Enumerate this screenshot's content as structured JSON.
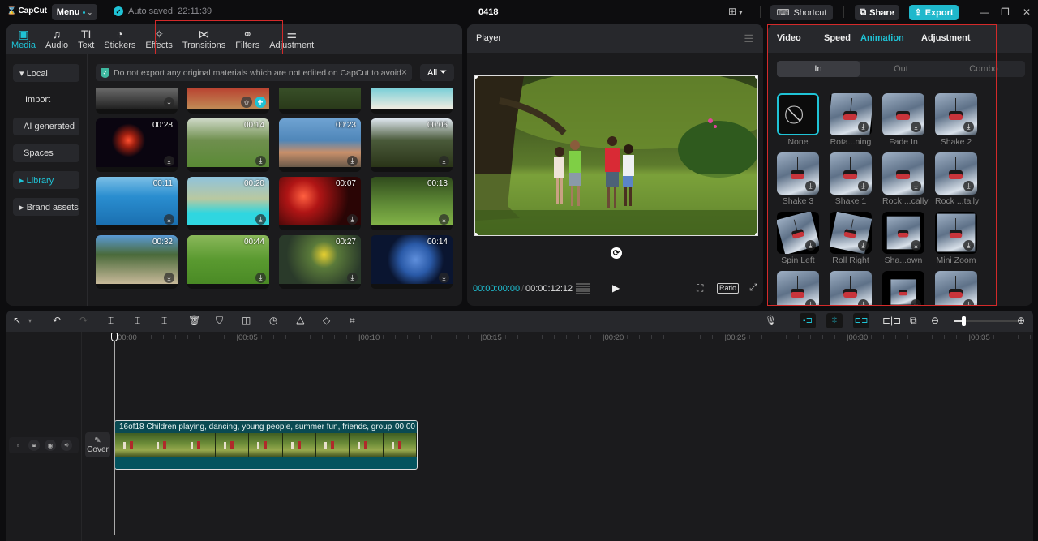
{
  "titlebar": {
    "app_name": "CapCut",
    "menu_label": "Menu",
    "autosave_text": "Auto saved: 22:11:39",
    "project_name": "0418",
    "shortcut_label": "Shortcut",
    "share_label": "Share",
    "export_label": "Export",
    "accent_color": "#1fc3d6"
  },
  "media_tabs": [
    {
      "label": "Media",
      "icon": "media-icon",
      "glyph": "▣",
      "active": true
    },
    {
      "label": "Audio",
      "icon": "audio-icon",
      "glyph": "♫",
      "active": false
    },
    {
      "label": "Text",
      "icon": "text-icon",
      "glyph": "TI",
      "active": false
    },
    {
      "label": "Stickers",
      "icon": "stickers-icon",
      "glyph": "◔",
      "active": false
    },
    {
      "label": "Effects",
      "icon": "effects-icon",
      "glyph": "✧",
      "active": false
    },
    {
      "label": "Transitions",
      "icon": "transitions-icon",
      "glyph": "⋈",
      "active": false
    },
    {
      "label": "Filters",
      "icon": "filters-icon",
      "glyph": "⚭",
      "active": false
    },
    {
      "label": "Adjustment",
      "icon": "adjustment-icon",
      "glyph": "⚌",
      "active": false
    }
  ],
  "media_sidebar": [
    {
      "label": "▾ Local",
      "active": false
    },
    {
      "label": "Import",
      "active": false
    },
    {
      "label": "AI generated",
      "active": false
    },
    {
      "label": "Spaces",
      "active": false
    },
    {
      "label": "▸ Library",
      "active": true
    },
    {
      "label": "▸ Brand assets",
      "active": false
    }
  ],
  "notice": {
    "text": "Do not export any original materials which are not edited on CapCut to avoid",
    "close": "×"
  },
  "filter_label": "All",
  "media_grid": [
    {
      "duration": "",
      "scene": "test pattern"
    },
    {
      "duration": "",
      "scene": "red tins"
    },
    {
      "duration": "",
      "scene": "forest"
    },
    {
      "duration": "",
      "scene": "beach"
    },
    {
      "duration": "00:28",
      "scene": "fireworks"
    },
    {
      "duration": "00:14",
      "scene": "girls dancing"
    },
    {
      "duration": "00:23",
      "scene": "friends at sea cliff"
    },
    {
      "duration": "00:06",
      "scene": "pine trees sunset"
    },
    {
      "duration": "00:11",
      "scene": "blue sea"
    },
    {
      "duration": "00:20",
      "scene": "pool"
    },
    {
      "duration": "00:07",
      "scene": "red fireworks"
    },
    {
      "duration": "00:13",
      "scene": "children in park"
    },
    {
      "duration": "00:32",
      "scene": "hiker"
    },
    {
      "duration": "00:44",
      "scene": "kitten in grass"
    },
    {
      "duration": "00:27",
      "scene": "yellow flowers"
    },
    {
      "duration": "00:14",
      "scene": "earth"
    }
  ],
  "player": {
    "title": "Player",
    "current_time": "00:00:00:00",
    "separator": "/",
    "total_time": "00:00:12:12",
    "ratio_label": "Ratio"
  },
  "props": {
    "tabs": [
      {
        "label": "Video",
        "active": false
      },
      {
        "label": "Speed",
        "active": false
      },
      {
        "label": "Animation",
        "active": true
      },
      {
        "label": "Adjustment",
        "active": false
      }
    ],
    "segments": [
      {
        "label": "In",
        "active": true
      },
      {
        "label": "Out",
        "active": false
      },
      {
        "label": "Combo",
        "active": false
      }
    ],
    "animations": [
      {
        "label": "None",
        "selected": true
      },
      {
        "label": "Rota...ning",
        "selected": false
      },
      {
        "label": "Fade In",
        "selected": false
      },
      {
        "label": "Shake 2",
        "selected": false
      },
      {
        "label": "Shake 3",
        "selected": false
      },
      {
        "label": "Shake 1",
        "selected": false
      },
      {
        "label": "Rock ...cally",
        "selected": false
      },
      {
        "label": "Rock ...tally",
        "selected": false
      },
      {
        "label": "Spin Left",
        "selected": false
      },
      {
        "label": "Roll Right",
        "selected": false
      },
      {
        "label": "Sha...own",
        "selected": false
      },
      {
        "label": "Mini Zoom",
        "selected": false
      },
      {
        "label": "",
        "selected": false
      },
      {
        "label": "",
        "selected": false
      },
      {
        "label": "",
        "selected": false
      },
      {
        "label": "",
        "selected": false
      }
    ]
  },
  "timeline": {
    "ruler_labels": [
      "00:00",
      "|00:05",
      "|00:10",
      "|00:15",
      "|00:20",
      "|00:25",
      "|00:30",
      "|00:35"
    ],
    "clip_name": "16of18 Children playing, dancing, young people, summer fun, friends, group",
    "clip_duration": "00:00",
    "cover_label": "Cover",
    "zoom_level": 0.15
  }
}
